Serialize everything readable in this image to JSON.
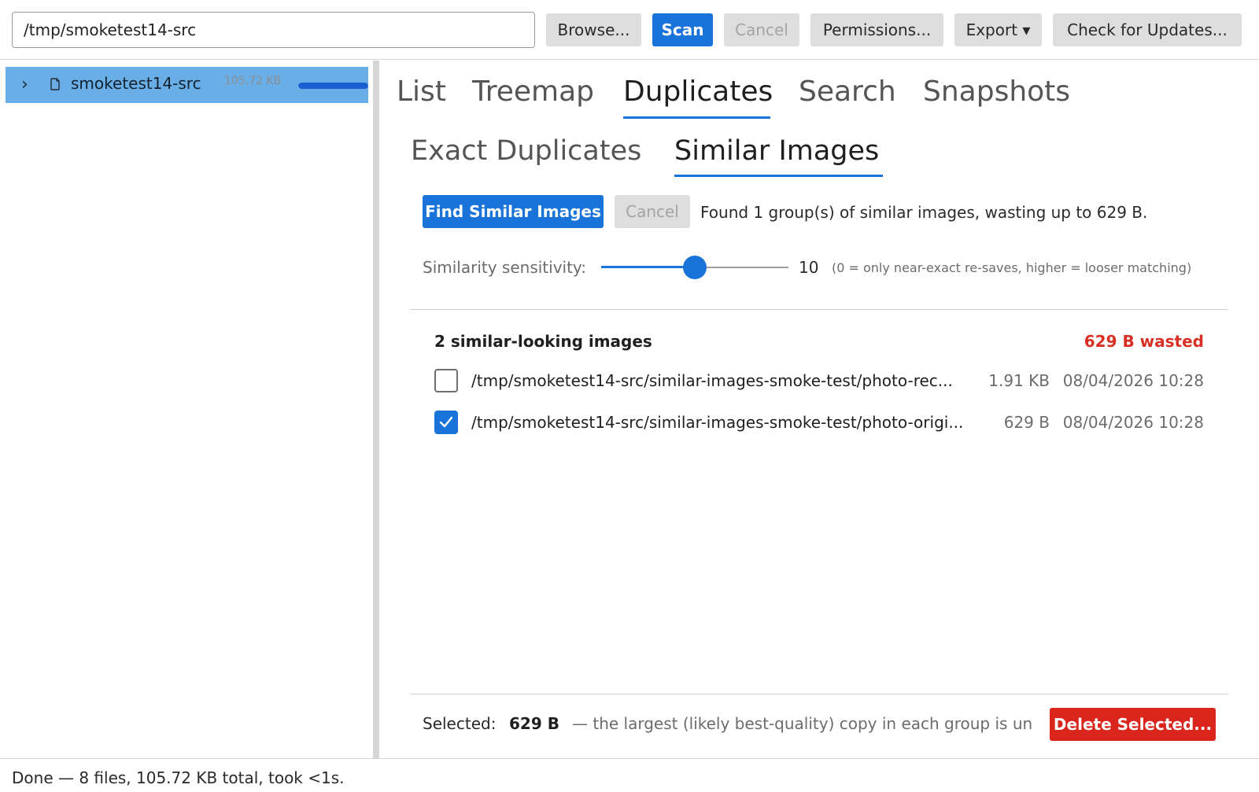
{
  "toolbar": {
    "path_value": "/tmp/smoketest14-src",
    "browse_label": "Browse...",
    "scan_label": "Scan",
    "cancel_label": "Cancel",
    "permissions_label": "Permissions...",
    "export_label": "Export ▾",
    "updates_label": "Check for Updates..."
  },
  "sidebar": {
    "items": [
      {
        "label": "smoketest14-src",
        "size": "105.72 KB",
        "fill_fraction": 1.0
      }
    ]
  },
  "tabs": [
    {
      "label": "List",
      "active": false
    },
    {
      "label": "Treemap",
      "active": false
    },
    {
      "label": "Duplicates",
      "active": true
    },
    {
      "label": "Search",
      "active": false
    },
    {
      "label": "Snapshots",
      "active": false
    }
  ],
  "subtabs": [
    {
      "label": "Exact Duplicates",
      "active": false
    },
    {
      "label": "Similar Images",
      "active": true
    }
  ],
  "actions": {
    "find_label": "Find Similar Images",
    "cancel_label": "Cancel",
    "status": "Found 1 group(s) of similar images, wasting up to 629 B."
  },
  "slider": {
    "label": "Similarity sensitivity:",
    "value": "10",
    "min": 0,
    "max": 20,
    "hint": "(0 = only near-exact re-saves, higher = looser matching)"
  },
  "group": {
    "title": "2 similar-looking images",
    "wasted": "629 B wasted",
    "files": [
      {
        "path": "/tmp/smoketest14-src/similar-images-smoke-test/photo-rec...",
        "size": "1.91 KB",
        "date": "08/04/2026 10:28",
        "checked": false
      },
      {
        "path": "/tmp/smoketest14-src/similar-images-smoke-test/photo-origi...",
        "size": "629 B",
        "date": "08/04/2026 10:28",
        "checked": true
      }
    ]
  },
  "footer": {
    "selected_label": "Selected:",
    "selected_value": "629 B",
    "note": "— the largest (likely best-quality) copy in each group is un",
    "delete_label": "Delete Selected..."
  },
  "statusbar": {
    "text": "Done — 8 files, 105.72 KB total, took <1s."
  },
  "colors": {
    "accent": "#1a73d9",
    "danger": "#d9251c",
    "selection": "#6aaee8"
  }
}
